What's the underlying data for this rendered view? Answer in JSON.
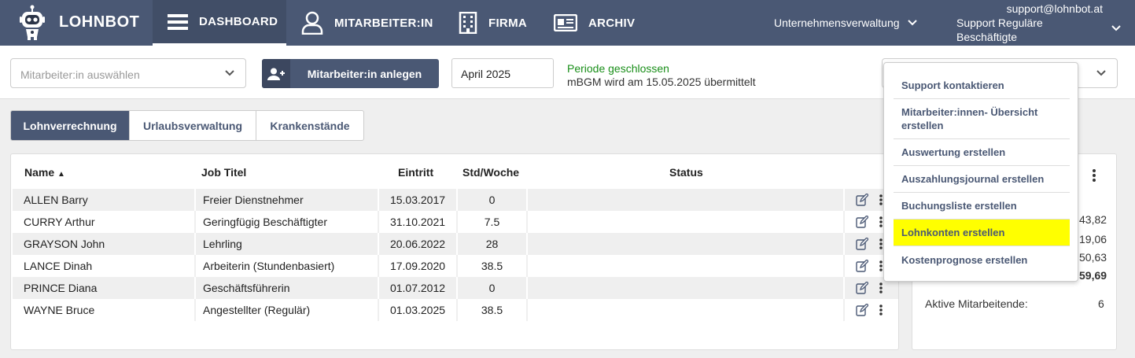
{
  "nav": {
    "brand": "LOHNBOT",
    "items": [
      {
        "label": "DASHBOARD",
        "icon": "hamburger-icon",
        "active": true
      },
      {
        "label": "MITARBEITER:IN",
        "icon": "user-icon"
      },
      {
        "label": "FIRMA",
        "icon": "building-icon"
      },
      {
        "label": "ARCHIV",
        "icon": "archive-icon"
      }
    ],
    "company_menu": "Unternehmensverwaltung",
    "user_email": "support@lohnbot.at",
    "user_role": "Support Reguläre Beschäftigte",
    "colors": {
      "bar": "#4a5874",
      "active": "#414e67"
    }
  },
  "toolbar": {
    "employee_placeholder": "Mitarbeiter:in auswählen",
    "add_employee_label": "Mitarbeiter:in anlegen",
    "period": "April 2025",
    "period_status": "Periode geschlossen",
    "period_note": "mBGM wird am 15.05.2025 übermittelt",
    "status_color": "#1a8f1a"
  },
  "tabs": [
    {
      "label": "Lohnverrechnung",
      "active": true
    },
    {
      "label": "Urlaubsverwaltung"
    },
    {
      "label": "Krankenstände"
    }
  ],
  "table": {
    "headers": {
      "name": "Name",
      "job": "Job Titel",
      "eintritt": "Eintritt",
      "std": "Std/Woche",
      "status": "Status"
    },
    "sort_indicator": "▲",
    "rows": [
      {
        "name": "ALLEN Barry",
        "job": "Freier Dienstnehmer",
        "eintritt": "15.03.2017",
        "std": "0"
      },
      {
        "name": "CURRY Arthur",
        "job": "Geringfügig Beschäftigter",
        "eintritt": "31.10.2021",
        "std": "7.5"
      },
      {
        "name": "GRAYSON John",
        "job": "Lehrling",
        "eintritt": "20.06.2022",
        "std": "28"
      },
      {
        "name": "LANCE Dinah",
        "job": "Arbeiterin (Stundenbasiert)",
        "eintritt": "17.09.2020",
        "std": "38.5"
      },
      {
        "name": "PRINCE Diana",
        "job": "Geschäftsführerin",
        "eintritt": "01.07.2012",
        "std": "0"
      },
      {
        "name": "WAYNE Bruce",
        "job": "Angestellter (Regulär)",
        "eintritt": "01.03.2025",
        "std": "38.5"
      }
    ]
  },
  "summary": {
    "values": [
      "43,82",
      "19,06",
      "50,63",
      "59,69"
    ],
    "active_label": "Aktive Mitarbeitende:",
    "active_count": "6"
  },
  "menu": {
    "items": [
      {
        "label": "Support kontaktieren"
      },
      {
        "label": "Mitarbeiter:innen- Übersicht erstellen"
      },
      {
        "label": "Auswertung erstellen"
      },
      {
        "label": "Auszahlungsjournal erstellen"
      },
      {
        "label": "Buchungsliste erstellen"
      },
      {
        "label": "Lohnkonten erstellen",
        "highlighted": true
      },
      {
        "label": "Kostenprognose erstellen"
      }
    ],
    "highlight_color": "#ffff00"
  }
}
